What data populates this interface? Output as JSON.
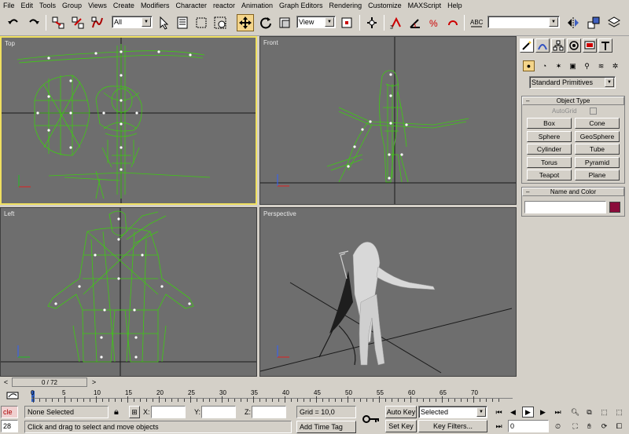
{
  "menu": [
    "File",
    "Edit",
    "Tools",
    "Group",
    "Views",
    "Create",
    "Modifiers",
    "Character",
    "reactor",
    "Animation",
    "Graph Editors",
    "Rendering",
    "Customize",
    "MAXScript",
    "Help"
  ],
  "toolbar": {
    "selection_filter": "All",
    "ref_coord": "View",
    "named_selection": "",
    "icons": [
      "undo-icon",
      "redo-icon",
      "link-icon",
      "unlink-icon",
      "bind-space-warp-icon",
      "select-object-icon",
      "select-by-name-icon",
      "rect-region-icon",
      "window-crossing-icon",
      "select-move-icon",
      "select-rotate-icon",
      "select-scale-icon",
      "pivot-icon",
      "snap-icon",
      "angle-snap-icon",
      "percent-snap-icon",
      "spinner-snap-icon",
      "mirror-icon",
      "align-icon"
    ]
  },
  "viewports": {
    "top": "Top",
    "front": "Front",
    "left": "Left",
    "perspective": "Perspective"
  },
  "command_panel": {
    "category": "Standard Primitives",
    "object_type_title": "Object Type",
    "autogrid": "AutoGrid",
    "buttons": [
      "Box",
      "Cone",
      "Sphere",
      "GeoSphere",
      "Cylinder",
      "Tube",
      "Torus",
      "Pyramid",
      "Teapot",
      "Plane"
    ],
    "name_color_title": "Name and Color",
    "name_value": "",
    "swatch_color": "#8a0c3a"
  },
  "timeline": {
    "frame_display": "0 / 72",
    "ticks": [
      "0",
      "5",
      "10",
      "15",
      "20",
      "25",
      "30",
      "35",
      "40",
      "45",
      "50",
      "55",
      "60",
      "65",
      "70"
    ]
  },
  "status": {
    "script_cmd": "cle",
    "script_num": "28",
    "selection": "None Selected",
    "prompt": "Click and drag to select and move objects",
    "x_label": "X:",
    "y_label": "Y:",
    "z_label": "Z:",
    "x": "",
    "y": "",
    "z": "",
    "grid": "Grid = 10,0",
    "add_time_tag": "Add Time Tag",
    "auto_key": "Auto Key",
    "set_key": "Set Key",
    "key_mode": "Selected",
    "key_filters": "Key Filters...",
    "frame": "0"
  },
  "colors": {
    "wire": "#3ecb12",
    "viewport_bg": "#6e6e6e",
    "active_border": "#f0e060"
  }
}
